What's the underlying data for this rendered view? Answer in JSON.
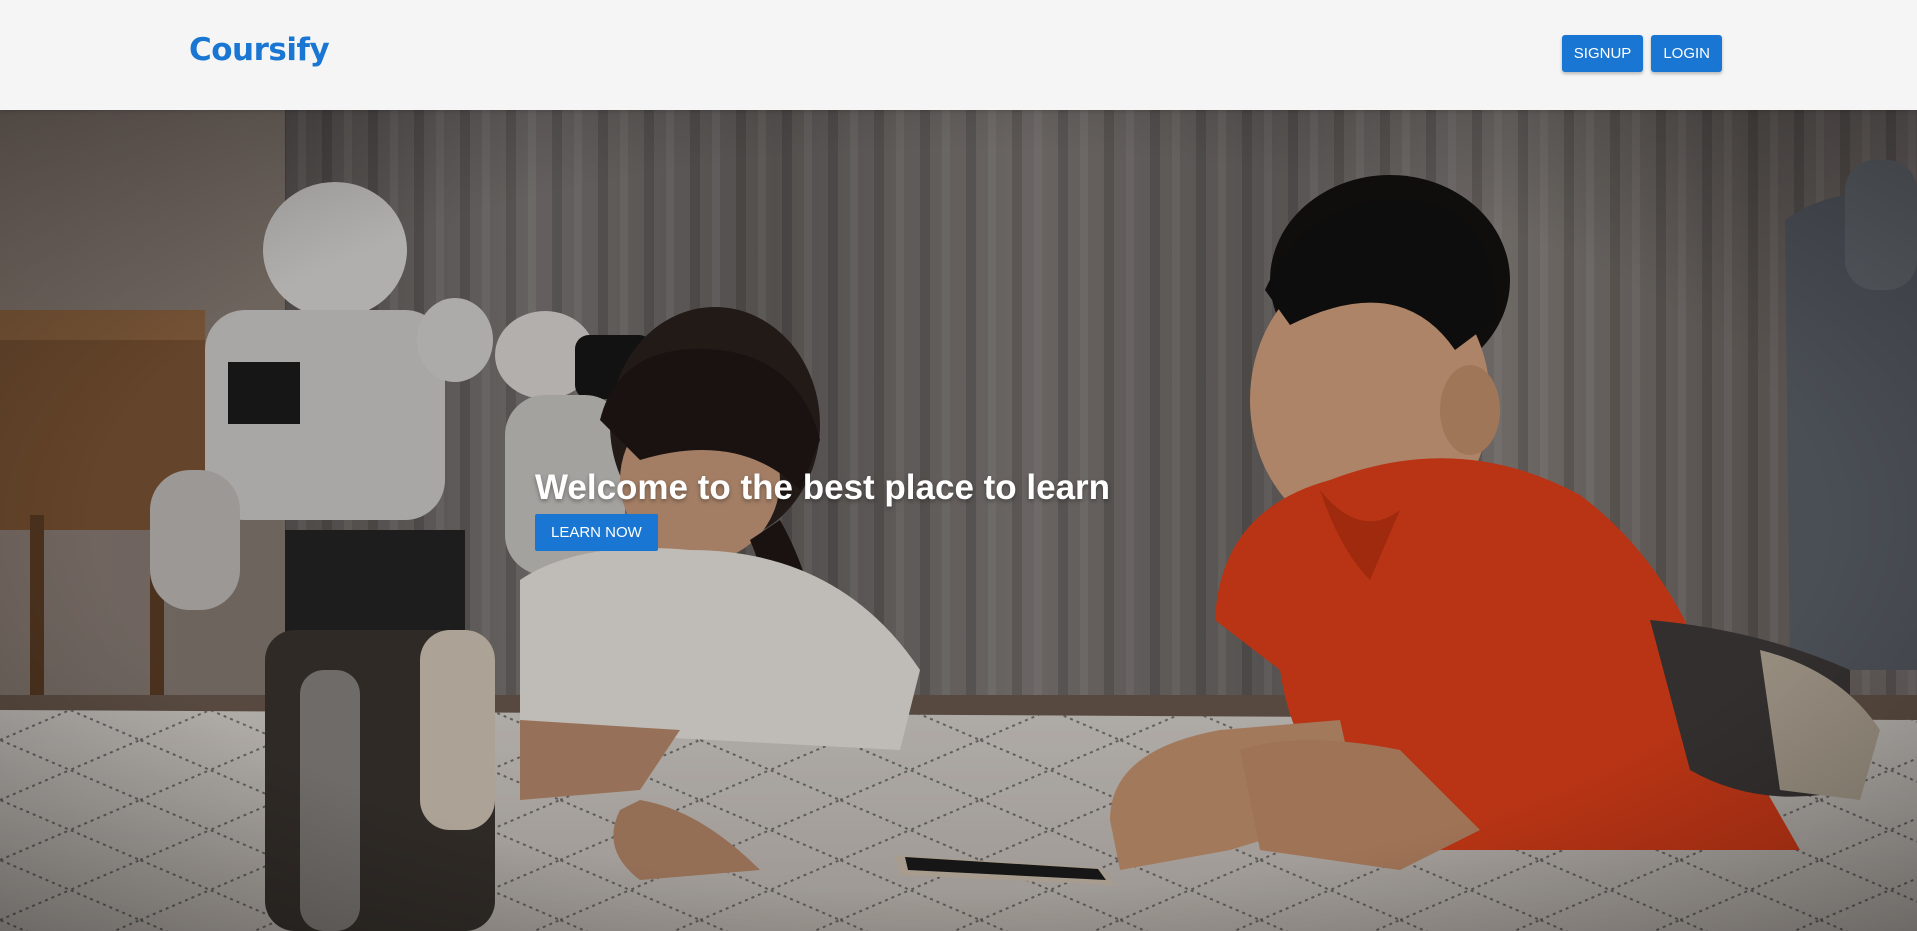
{
  "app": {
    "brand": "Coursify",
    "brand_color": "#1976d2"
  },
  "nav": {
    "signup_label": "SIGNUP",
    "login_label": "LOGIN"
  },
  "hero": {
    "title": "Welcome to the best place to learn",
    "cta_label": "LEARN NOW",
    "image_description_icon": "hero-photo"
  }
}
